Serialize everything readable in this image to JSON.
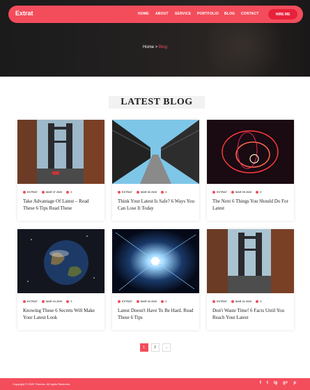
{
  "brand": "Extrat",
  "nav": [
    "HOME",
    "ABOUT",
    "SERVICE",
    "PORTFOLIO",
    "BLOG",
    "CONTACT"
  ],
  "hire_label": "HIRE ME",
  "breadcrumb": {
    "home": "Home",
    "sep": ">",
    "current": "Blog"
  },
  "section_title": "LATEST BLOG",
  "posts": [
    {
      "cat": "EXTRAT",
      "date": "MAR 07 2020",
      "comments": "0",
      "title": "Take Advantage Of Latest – Read These 6 Tips Read These",
      "image": "bridge-street"
    },
    {
      "cat": "EXTRAT",
      "date": "MAR 06 2020",
      "comments": "0",
      "title": "Think Your Latest Is Safe? 6 Ways You Can Lose It Today",
      "image": "bridge-walkway"
    },
    {
      "cat": "EXTRAT",
      "date": "MAR 05 2020",
      "comments": "0",
      "title": "The Next 6 Things You Should Do For Latest",
      "image": "light-swirl"
    },
    {
      "cat": "EXTRAT",
      "date": "MAR 04 2020",
      "comments": "0",
      "title": "Knowing These 6 Secrets Will Make Your Latest Look",
      "image": "planet-earth"
    },
    {
      "cat": "EXTRAT",
      "date": "MAR 03 2020",
      "comments": "0",
      "title": "Latest Doesn't Have To Be Hard. Read These 6 Tips",
      "image": "light-burst"
    },
    {
      "cat": "EXTRAT",
      "date": "MAR 02 2020",
      "comments": "0",
      "title": "Don't Waste Time! 6 Facts Until You Reach Your Latest",
      "image": "bridge-street"
    }
  ],
  "pagination": [
    "1",
    "2",
    "→"
  ],
  "footer": {
    "copyright": "Copyright © 2020 Themes. All rights Reserved.",
    "social": [
      "f",
      "t",
      "ig",
      "g+",
      "p"
    ]
  },
  "colors": {
    "accent": "#f34d5c",
    "dark": "#1b1b1b"
  }
}
